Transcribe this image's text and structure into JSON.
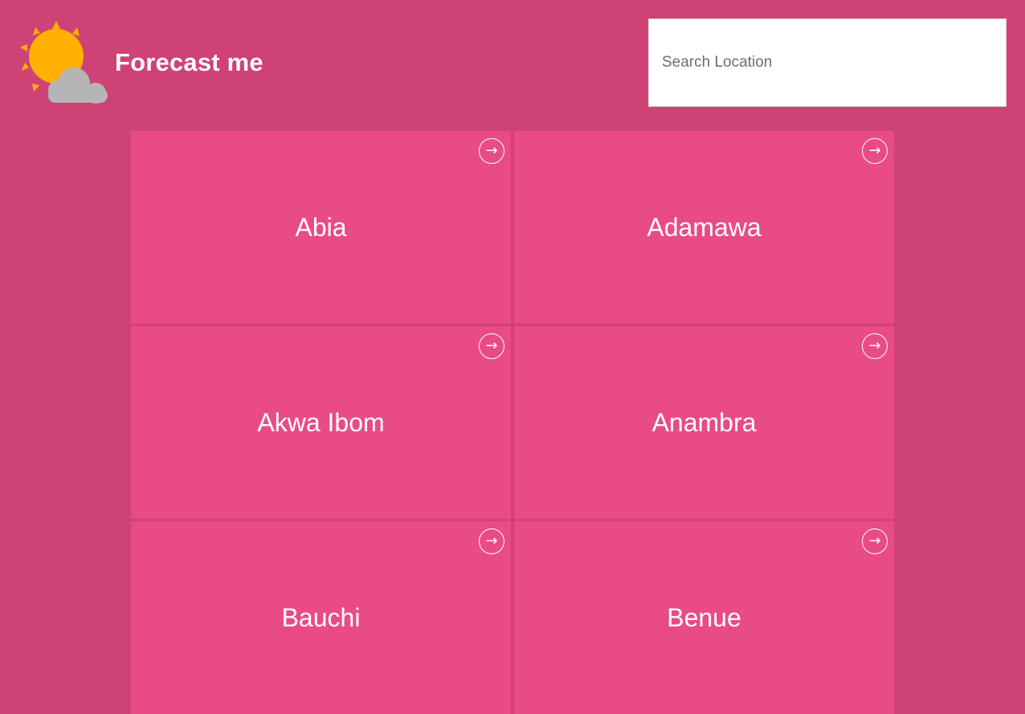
{
  "header": {
    "title": "Forecast me",
    "logo_icon": "partly-cloudy-sun-icon"
  },
  "search": {
    "placeholder": "Search Location",
    "value": ""
  },
  "colors": {
    "background": "#cf4275",
    "card": "#e94b87",
    "sun": "#ffb000",
    "cloud": "#b5b5b5"
  },
  "states": [
    {
      "name": "Abia",
      "icon": "arrow-right-icon",
      "arrow": "→"
    },
    {
      "name": "Adamawa",
      "icon": "arrow-right-icon",
      "arrow": "→"
    },
    {
      "name": "Akwa Ibom",
      "icon": "arrow-right-icon",
      "arrow": "→"
    },
    {
      "name": "Anambra",
      "icon": "arrow-right-icon",
      "arrow": "→"
    },
    {
      "name": "Bauchi",
      "icon": "arrow-right-icon",
      "arrow": "→"
    },
    {
      "name": "Benue",
      "icon": "arrow-right-icon",
      "arrow": "→"
    }
  ]
}
